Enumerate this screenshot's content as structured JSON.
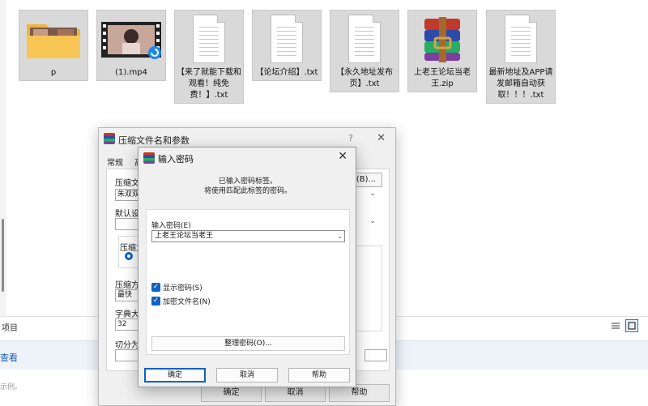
{
  "explorer": {
    "files": [
      {
        "label": "p",
        "kind": "folder",
        "icon": "folder-icon"
      },
      {
        "label": "(1).mp4",
        "kind": "video",
        "icon": "video-icon"
      },
      {
        "label": "【来了就能下载和观看！纯免费！】.txt",
        "kind": "txt",
        "icon": "text-file-icon"
      },
      {
        "label": "【论坛介绍】.txt",
        "kind": "txt",
        "icon": "text-file-icon"
      },
      {
        "label": "【永久地址发布页】.txt",
        "kind": "txt",
        "icon": "text-file-icon"
      },
      {
        "label": "上老王论坛当老王.zip",
        "kind": "zip",
        "icon": "winrar-archive-icon"
      },
      {
        "label": "最新地址及APP请发邮箱自动获取！！！.txt",
        "kind": "txt",
        "icon": "text-file-icon"
      }
    ],
    "status_text": "项目",
    "band_link": "查看",
    "bottom_text": "示例。"
  },
  "back_dialog": {
    "title": "压缩文件名和参数",
    "help_glyph": "?",
    "close_glyph": "✕",
    "tab_general": "常规",
    "tab_next": "高",
    "archive_name_label": "压缩文件",
    "archive_name_value": "朱双双",
    "browse_label": "(B)...",
    "default_settings_label": "默认设置",
    "format_group_label": "压缩文",
    "method_label": "压缩方式",
    "method_value": "最快",
    "dict_label": "字典大小",
    "dict_value": "32",
    "split_label": "切分为分",
    "ok_label": "确定",
    "cancel_label": "取消",
    "help_label": "帮助"
  },
  "password_dialog": {
    "title": "输入密码",
    "close_glyph": "✕",
    "info_line1": "已输入密码标签。",
    "info_line2": "将使用匹配此标签的密码。",
    "password_label": "输入密码(E)",
    "password_value": "上老王论坛当老王",
    "show_password_label": "显示密码(S)",
    "show_password_checked": true,
    "encrypt_names_label": "加密文件名(N)",
    "encrypt_names_checked": true,
    "organize_label": "整理密码(O)...",
    "ok_label": "确定",
    "cancel_label": "取消",
    "help_label": "帮助"
  },
  "colors": {
    "accent": "#0b63c5",
    "tile_selected": "#d9d9d9",
    "dialog_bg": "#f0f0f0"
  }
}
